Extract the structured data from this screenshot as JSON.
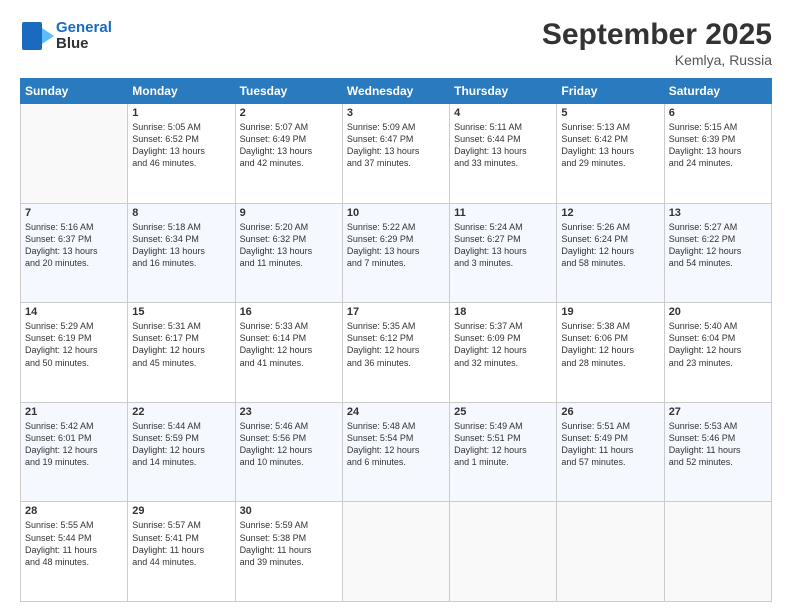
{
  "header": {
    "logo_line1": "General",
    "logo_line2": "Blue",
    "month": "September 2025",
    "location": "Kemlya, Russia"
  },
  "days_of_week": [
    "Sunday",
    "Monday",
    "Tuesday",
    "Wednesday",
    "Thursday",
    "Friday",
    "Saturday"
  ],
  "weeks": [
    [
      {
        "day": "",
        "info": ""
      },
      {
        "day": "1",
        "info": "Sunrise: 5:05 AM\nSunset: 6:52 PM\nDaylight: 13 hours\nand 46 minutes."
      },
      {
        "day": "2",
        "info": "Sunrise: 5:07 AM\nSunset: 6:49 PM\nDaylight: 13 hours\nand 42 minutes."
      },
      {
        "day": "3",
        "info": "Sunrise: 5:09 AM\nSunset: 6:47 PM\nDaylight: 13 hours\nand 37 minutes."
      },
      {
        "day": "4",
        "info": "Sunrise: 5:11 AM\nSunset: 6:44 PM\nDaylight: 13 hours\nand 33 minutes."
      },
      {
        "day": "5",
        "info": "Sunrise: 5:13 AM\nSunset: 6:42 PM\nDaylight: 13 hours\nand 29 minutes."
      },
      {
        "day": "6",
        "info": "Sunrise: 5:15 AM\nSunset: 6:39 PM\nDaylight: 13 hours\nand 24 minutes."
      }
    ],
    [
      {
        "day": "7",
        "info": "Sunrise: 5:16 AM\nSunset: 6:37 PM\nDaylight: 13 hours\nand 20 minutes."
      },
      {
        "day": "8",
        "info": "Sunrise: 5:18 AM\nSunset: 6:34 PM\nDaylight: 13 hours\nand 16 minutes."
      },
      {
        "day": "9",
        "info": "Sunrise: 5:20 AM\nSunset: 6:32 PM\nDaylight: 13 hours\nand 11 minutes."
      },
      {
        "day": "10",
        "info": "Sunrise: 5:22 AM\nSunset: 6:29 PM\nDaylight: 13 hours\nand 7 minutes."
      },
      {
        "day": "11",
        "info": "Sunrise: 5:24 AM\nSunset: 6:27 PM\nDaylight: 13 hours\nand 3 minutes."
      },
      {
        "day": "12",
        "info": "Sunrise: 5:26 AM\nSunset: 6:24 PM\nDaylight: 12 hours\nand 58 minutes."
      },
      {
        "day": "13",
        "info": "Sunrise: 5:27 AM\nSunset: 6:22 PM\nDaylight: 12 hours\nand 54 minutes."
      }
    ],
    [
      {
        "day": "14",
        "info": "Sunrise: 5:29 AM\nSunset: 6:19 PM\nDaylight: 12 hours\nand 50 minutes."
      },
      {
        "day": "15",
        "info": "Sunrise: 5:31 AM\nSunset: 6:17 PM\nDaylight: 12 hours\nand 45 minutes."
      },
      {
        "day": "16",
        "info": "Sunrise: 5:33 AM\nSunset: 6:14 PM\nDaylight: 12 hours\nand 41 minutes."
      },
      {
        "day": "17",
        "info": "Sunrise: 5:35 AM\nSunset: 6:12 PM\nDaylight: 12 hours\nand 36 minutes."
      },
      {
        "day": "18",
        "info": "Sunrise: 5:37 AM\nSunset: 6:09 PM\nDaylight: 12 hours\nand 32 minutes."
      },
      {
        "day": "19",
        "info": "Sunrise: 5:38 AM\nSunset: 6:06 PM\nDaylight: 12 hours\nand 28 minutes."
      },
      {
        "day": "20",
        "info": "Sunrise: 5:40 AM\nSunset: 6:04 PM\nDaylight: 12 hours\nand 23 minutes."
      }
    ],
    [
      {
        "day": "21",
        "info": "Sunrise: 5:42 AM\nSunset: 6:01 PM\nDaylight: 12 hours\nand 19 minutes."
      },
      {
        "day": "22",
        "info": "Sunrise: 5:44 AM\nSunset: 5:59 PM\nDaylight: 12 hours\nand 14 minutes."
      },
      {
        "day": "23",
        "info": "Sunrise: 5:46 AM\nSunset: 5:56 PM\nDaylight: 12 hours\nand 10 minutes."
      },
      {
        "day": "24",
        "info": "Sunrise: 5:48 AM\nSunset: 5:54 PM\nDaylight: 12 hours\nand 6 minutes."
      },
      {
        "day": "25",
        "info": "Sunrise: 5:49 AM\nSunset: 5:51 PM\nDaylight: 12 hours\nand 1 minute."
      },
      {
        "day": "26",
        "info": "Sunrise: 5:51 AM\nSunset: 5:49 PM\nDaylight: 11 hours\nand 57 minutes."
      },
      {
        "day": "27",
        "info": "Sunrise: 5:53 AM\nSunset: 5:46 PM\nDaylight: 11 hours\nand 52 minutes."
      }
    ],
    [
      {
        "day": "28",
        "info": "Sunrise: 5:55 AM\nSunset: 5:44 PM\nDaylight: 11 hours\nand 48 minutes."
      },
      {
        "day": "29",
        "info": "Sunrise: 5:57 AM\nSunset: 5:41 PM\nDaylight: 11 hours\nand 44 minutes."
      },
      {
        "day": "30",
        "info": "Sunrise: 5:59 AM\nSunset: 5:38 PM\nDaylight: 11 hours\nand 39 minutes."
      },
      {
        "day": "",
        "info": ""
      },
      {
        "day": "",
        "info": ""
      },
      {
        "day": "",
        "info": ""
      },
      {
        "day": "",
        "info": ""
      }
    ]
  ]
}
